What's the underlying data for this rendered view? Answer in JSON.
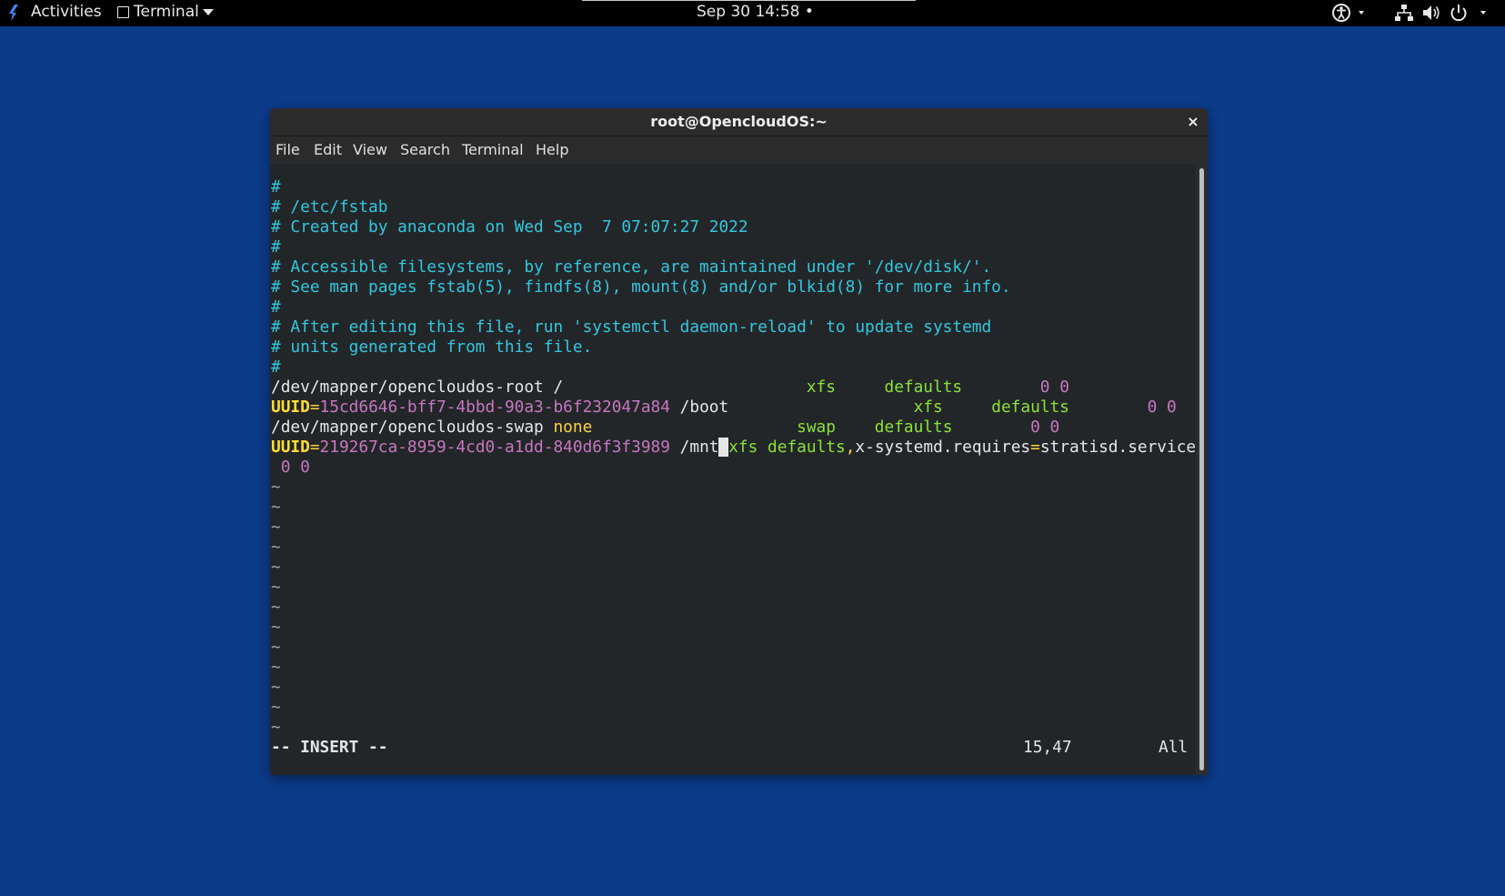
{
  "topbar": {
    "activities": "Activities",
    "app_menu": "Terminal",
    "clock": "Sep 30  14:58 •"
  },
  "window": {
    "title": "root@OpencloudOS:~",
    "close": "×",
    "menu": [
      "File",
      "Edit",
      "View",
      "Search",
      "Terminal",
      "Help"
    ]
  },
  "editor": {
    "comments": [
      "#",
      "# /etc/fstab",
      "# Created by anaconda on Wed Sep  7 07:07:27 2022",
      "#",
      "# Accessible filesystems, by reference, are maintained under '/dev/disk/'.",
      "# See man pages fstab(5), findfs(8), mount(8) and/or blkid(8) for more info.",
      "#",
      "# After editing this file, run 'systemctl daemon-reload' to update systemd",
      "# units generated from this file.",
      "#"
    ],
    "entries": [
      {
        "device": "/dev/mapper/opencloudos-root",
        "mount": "/",
        "fstype": "xfs",
        "options": "defaults",
        "dump": "0",
        "pass": "0"
      },
      {
        "uuid_key": "UUID",
        "uuid": "15cd6646-bff7-4bbd-90a3-b6f232047a84",
        "mount": "/boot",
        "fstype": "xfs",
        "options": "defaults",
        "dump": "0",
        "pass": "0"
      },
      {
        "device": "/dev/mapper/opencloudos-swap",
        "mount": "none",
        "fstype": "swap",
        "options": "defaults",
        "dump": "0",
        "pass": "0"
      },
      {
        "uuid_key": "UUID",
        "uuid": "219267ca-8959-4cd0-a1dd-840d6f3f3989",
        "mount": "/mnt",
        "fstype": "xfs",
        "options_a": "defaults",
        "options_b": "x-systemd.requires",
        "options_c": "stratisd.service",
        "dump": "0",
        "pass": "0"
      }
    ],
    "tilde": "~",
    "mode": "-- INSERT --",
    "position": "15,47",
    "scroll": "All"
  }
}
